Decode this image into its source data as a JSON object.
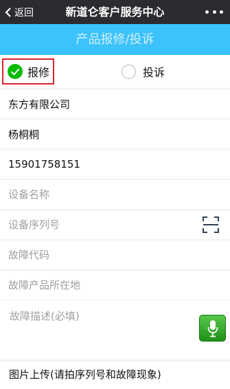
{
  "navbar": {
    "back_label": "返回",
    "title": "新道仑客户服务中心"
  },
  "header": {
    "title": "产品报修/投诉"
  },
  "type_selector": {
    "repair_label": "报修",
    "complaint_label": "投诉",
    "selected": "报修"
  },
  "form": {
    "company": "东方有限公司",
    "contact_name": "杨桐桐",
    "phone": "15901758151",
    "device_name_placeholder": "设备名称",
    "serial_placeholder": "设备序列号",
    "fault_code_placeholder": "故障代码",
    "location_placeholder": "故障产品所在地",
    "description_placeholder": "故障描述(必填)",
    "upload_label": "图片上传(请拍序列号和故障现象)"
  },
  "colors": {
    "navbar": "#2b2b30",
    "header": "#3cc3fb",
    "selected_radio": "#09bb07",
    "highlight_border": "#d9232b",
    "mic_button": "#2da524"
  },
  "icons": {
    "back": "chevron-left-icon",
    "more": "more-dots-icon",
    "selected": "check-circle-icon",
    "scan": "scan-icon",
    "voice": "microphone-icon"
  }
}
